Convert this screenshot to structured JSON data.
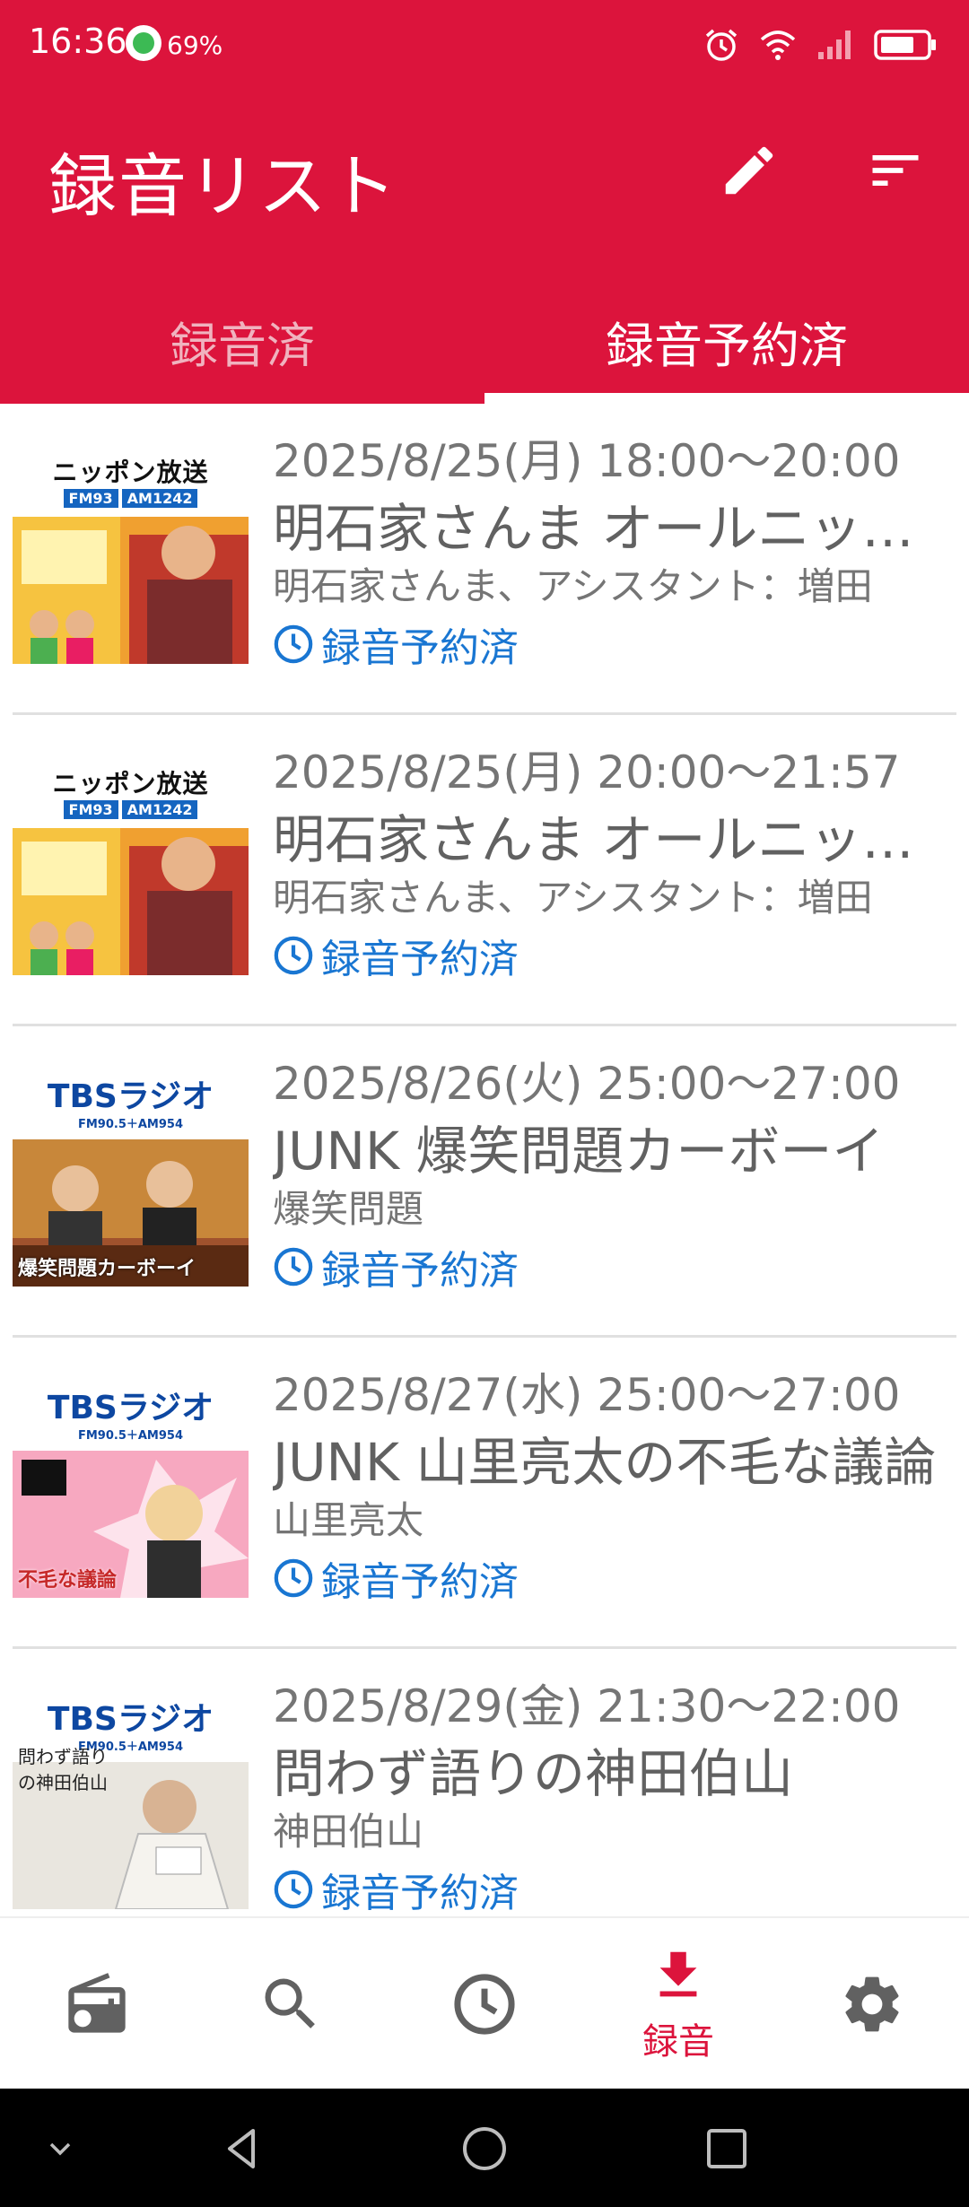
{
  "status_bar": {
    "time": "16:36",
    "battery_percent": "69%",
    "icons": [
      "alarm-icon",
      "wifi-icon",
      "signal-icon",
      "battery-icon"
    ]
  },
  "app_bar": {
    "title": "録音リスト",
    "actions": [
      "edit-icon",
      "sort-icon"
    ]
  },
  "tabs": [
    {
      "label": "録音済",
      "selected": false
    },
    {
      "label": "録音予約済",
      "selected": true
    }
  ],
  "colors": {
    "primary": "#dc143c",
    "status_text": "#1976d2"
  },
  "items": [
    {
      "station": "ニッポン放送",
      "station_sub": [
        "FM93",
        "AM1242"
      ],
      "art_caption": "",
      "datetime": "2025/8/25(月) 18:00〜20:00",
      "title": "明石家さんま オールニッポン お願い！リクエスト",
      "performers": "明石家さんま、アシスタント：増田",
      "status": "録音予約済"
    },
    {
      "station": "ニッポン放送",
      "station_sub": [
        "FM93",
        "AM1242"
      ],
      "art_caption": "",
      "datetime": "2025/8/25(月) 20:00〜21:57",
      "title": "明石家さんま オールニッポン お願い！リクエスト",
      "performers": "明石家さんま、アシスタント：増田",
      "status": "録音予約済"
    },
    {
      "station": "TBSラジオ",
      "station_sub": [
        "FM90.5＋AM954"
      ],
      "art_caption": "爆笑問題カーボーイ",
      "datetime": "2025/8/26(火) 25:00〜27:00",
      "title": "JUNK 爆笑問題カーボーイ",
      "performers": "爆笑問題",
      "status": "録音予約済"
    },
    {
      "station": "TBSラジオ",
      "station_sub": [
        "FM90.5＋AM954"
      ],
      "art_caption": "不毛な議論",
      "datetime": "2025/8/27(水) 25:00〜27:00",
      "title": "JUNK 山里亮太の不毛な議論",
      "performers": "山里亮太",
      "status": "録音予約済"
    },
    {
      "station": "TBSラジオ",
      "station_sub": [
        "FM90.5＋AM954"
      ],
      "art_caption": "問わず語りの神田伯山",
      "datetime": "2025/8/29(金) 21:30〜22:00",
      "title": "問わず語りの神田伯山",
      "performers": "神田伯山",
      "status": "録音予約済"
    }
  ],
  "bottom_nav": [
    {
      "icon": "radio-icon",
      "label": "",
      "active": false
    },
    {
      "icon": "search-icon",
      "label": "",
      "active": false
    },
    {
      "icon": "clock-icon",
      "label": "",
      "active": false
    },
    {
      "icon": "download-icon",
      "label": "録音",
      "active": true
    },
    {
      "icon": "settings-icon",
      "label": "",
      "active": false
    }
  ],
  "system_nav": [
    "collapse-icon",
    "back-icon",
    "home-icon",
    "recents-icon"
  ]
}
